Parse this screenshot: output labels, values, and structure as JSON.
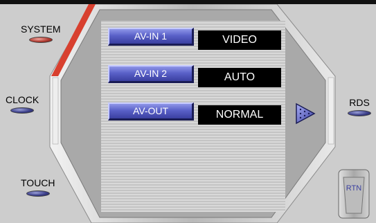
{
  "side_buttons": {
    "system": {
      "label": "SYSTEM",
      "active": true
    },
    "clock": {
      "label": "CLOCK",
      "active": false
    },
    "touch": {
      "label": "TOUCH",
      "active": false
    },
    "rds": {
      "label": "RDS",
      "active": false
    }
  },
  "rows": [
    {
      "button_label": "AV-IN 1",
      "value": "VIDEO"
    },
    {
      "button_label": "AV-IN 2",
      "value": "AUTO"
    },
    {
      "button_label": "AV-OUT",
      "value": "NORMAL"
    }
  ],
  "next_icon": "play-triangle-icon",
  "rtn_label": "RTN",
  "colors": {
    "button_blue": "#5a61c8",
    "active_red": "#c0392b",
    "value_box": "#000000",
    "panel_gray": "#cdcdcd"
  }
}
